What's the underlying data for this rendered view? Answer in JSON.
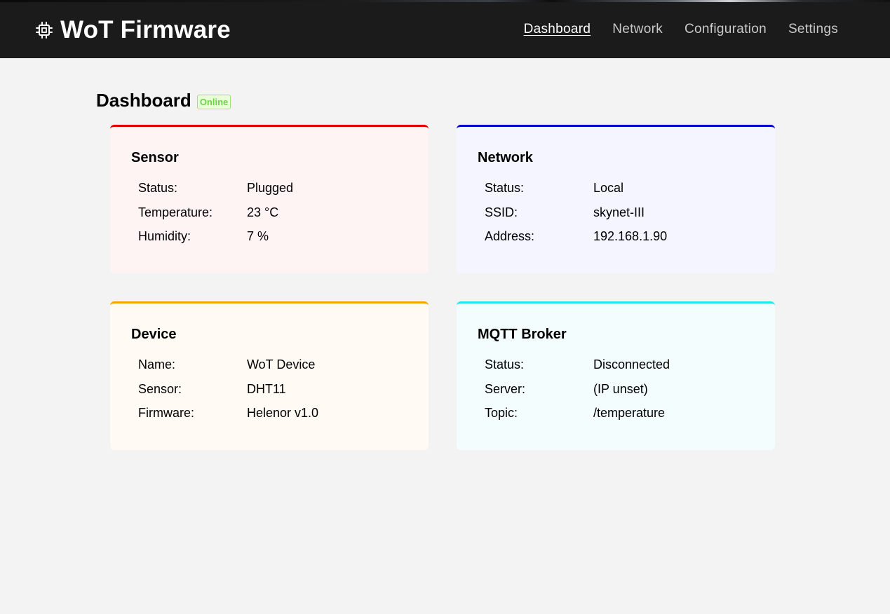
{
  "brand": {
    "title": "WoT Firmware",
    "icon": "chip-icon"
  },
  "nav": [
    {
      "label": "Dashboard",
      "active": true
    },
    {
      "label": "Network",
      "active": false
    },
    {
      "label": "Configuration",
      "active": false
    },
    {
      "label": "Settings",
      "active": false
    }
  ],
  "page": {
    "title": "Dashboard",
    "status_badge": "Online"
  },
  "colors": {
    "header_bg": "#1b1b1b",
    "sensor_accent": "#e00000",
    "network_accent": "#0000cc",
    "device_accent": "#f0a800",
    "mqtt_accent": "#22e8ec",
    "badge_text": "#6fd24c"
  },
  "cards": {
    "sensor": {
      "title": "Sensor",
      "rows": [
        {
          "label": "Status:",
          "value": "Plugged"
        },
        {
          "label": "Temperature:",
          "value": "23 °C"
        },
        {
          "label": "Humidity:",
          "value": "7 %"
        }
      ]
    },
    "network": {
      "title": "Network",
      "rows": [
        {
          "label": "Status:",
          "value": "Local"
        },
        {
          "label": "SSID:",
          "value": "skynet-III"
        },
        {
          "label": "Address:",
          "value": "192.168.1.90"
        }
      ]
    },
    "device": {
      "title": "Device",
      "rows": [
        {
          "label": "Name:",
          "value": "WoT Device"
        },
        {
          "label": "Sensor:",
          "value": "DHT11"
        },
        {
          "label": "Firmware:",
          "value": "Helenor v1.0"
        }
      ]
    },
    "mqtt": {
      "title": "MQTT Broker",
      "rows": [
        {
          "label": "Status:",
          "value": "Disconnected"
        },
        {
          "label": "Server:",
          "value": "(IP unset)"
        },
        {
          "label": "Topic:",
          "value": "/temperature"
        }
      ]
    }
  }
}
